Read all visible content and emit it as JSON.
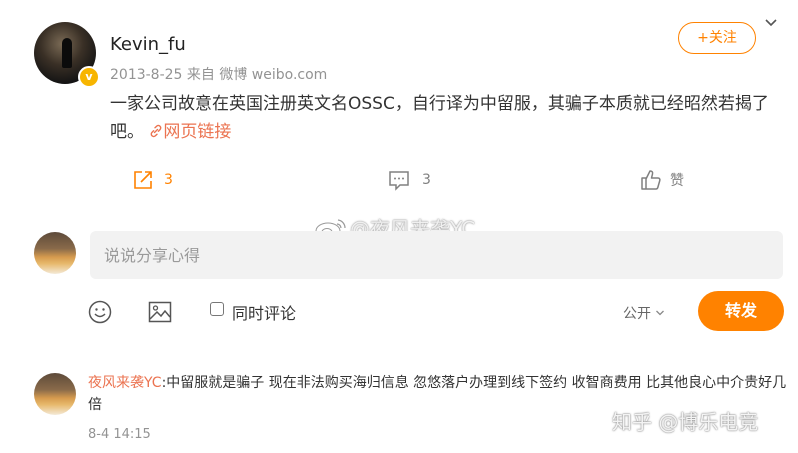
{
  "post": {
    "username": "Kevin_fu",
    "verified_badge": "v",
    "meta": "2013-8-25  来自 微博 weibo.com",
    "follow_label": "+关注",
    "text": "一家公司故意在英国注册英文名OSSC，自行译为中留服，其骗子本质就已经昭然若揭了吧。",
    "link_label": "网页链接"
  },
  "actions": {
    "repost_count": "3",
    "comment_count": "3",
    "like_label": "赞"
  },
  "watermarks": {
    "center": "@夜风来袭YC",
    "bottom": "知乎 @博乐电竞"
  },
  "composer": {
    "placeholder": "说说分享心得",
    "also_comment_label": "同时评论",
    "visibility_label": "公开",
    "submit_label": "转发"
  },
  "comment": {
    "user": "夜风来袭YC",
    "text": ":中留服就是骗子 现在非法购买海归信息 忽悠落户办理到线下签约 收智商费用 比其他良心中介贵好几倍",
    "time": "8-4 14:15"
  },
  "colors": {
    "accent": "#ff8200",
    "link": "#eb7350",
    "muted": "#939393",
    "badge": "#f7b500"
  },
  "icons": [
    "chevron-down-icon",
    "link-icon",
    "repost-icon",
    "comment-icon",
    "like-icon",
    "emoji-icon",
    "image-icon",
    "weibo-logo-icon"
  ]
}
